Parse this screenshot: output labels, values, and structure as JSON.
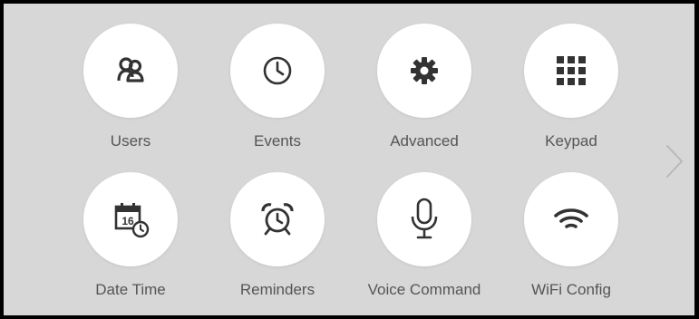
{
  "menu": {
    "items": [
      {
        "label": "Users",
        "icon": "users-icon"
      },
      {
        "label": "Events",
        "icon": "clock-icon"
      },
      {
        "label": "Advanced",
        "icon": "gear-icon"
      },
      {
        "label": "Keypad",
        "icon": "keypad-icon"
      },
      {
        "label": "Date Time",
        "icon": "calendar-clock-icon",
        "calendar_day": "16"
      },
      {
        "label": "Reminders",
        "icon": "alarm-clock-icon"
      },
      {
        "label": "Voice Command",
        "icon": "microphone-icon"
      },
      {
        "label": "WiFi Config",
        "icon": "wifi-icon"
      }
    ]
  },
  "navigation": {
    "next_icon": "chevron-right-icon"
  },
  "colors": {
    "background": "#d7d7d7",
    "tile": "#ffffff",
    "icon": "#333333",
    "label": "#555555",
    "chevron": "#b8b8b8"
  }
}
